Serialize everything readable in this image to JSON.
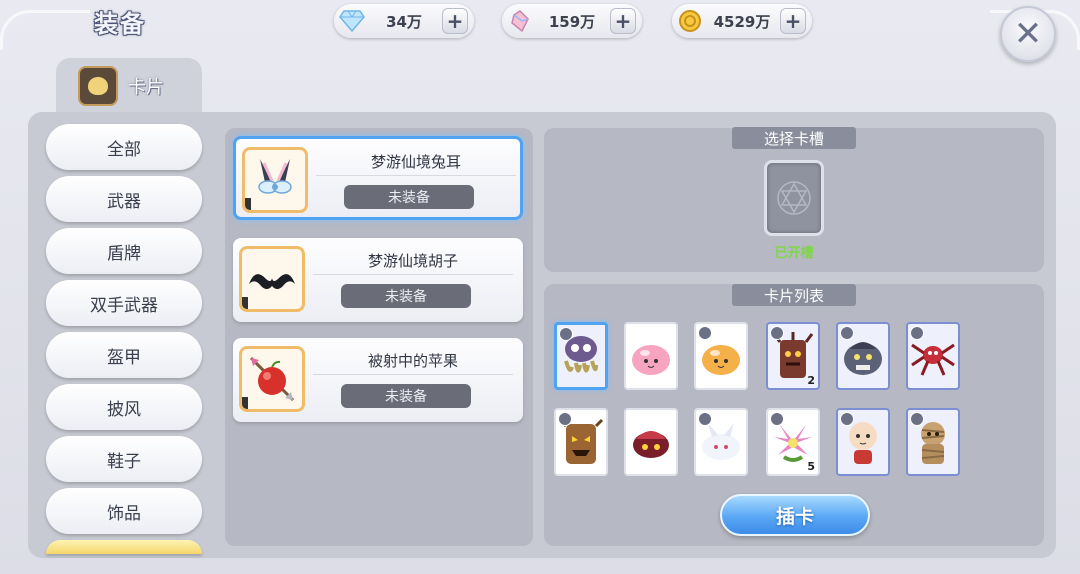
{
  "header": {
    "title": "装备",
    "currencies": [
      {
        "icon": "diamond-icon",
        "value": "34万"
      },
      {
        "icon": "crystal-icon",
        "value": "159万"
      },
      {
        "icon": "gold-coin-icon",
        "value": "4529万"
      }
    ],
    "plus_label": "+",
    "close_label": "✕"
  },
  "tab": {
    "label": "卡片",
    "icon": "card-tab-icon"
  },
  "categories": [
    "全部",
    "武器",
    "盾牌",
    "双手武器",
    "盔甲",
    "披风",
    "鞋子",
    "饰品"
  ],
  "items": [
    {
      "name": "梦游仙境兔耳",
      "status": "未装备",
      "icon": "bunny-ears-icon",
      "selected": true
    },
    {
      "name": "梦游仙境胡子",
      "status": "未装备",
      "icon": "mustache-icon",
      "selected": false
    },
    {
      "name": "被射中的苹果",
      "status": "未装备",
      "icon": "arrow-apple-icon",
      "selected": false
    }
  ],
  "slot": {
    "label": "选择卡槽",
    "status": "已开槽"
  },
  "card_list": {
    "label": "卡片列表",
    "cards": [
      {
        "name": "octopus-monster-card",
        "count": ""
      },
      {
        "name": "pink-poring-card",
        "count": ""
      },
      {
        "name": "orange-poring-card",
        "count": ""
      },
      {
        "name": "tree-monster-card",
        "count": "2"
      },
      {
        "name": "stone-golem-card",
        "count": ""
      },
      {
        "name": "red-spider-card",
        "count": ""
      },
      {
        "name": "tree-stump-card",
        "count": ""
      },
      {
        "name": "red-beetle-card",
        "count": ""
      },
      {
        "name": "white-lunatic-card",
        "count": ""
      },
      {
        "name": "flower-monster-card",
        "count": "5"
      },
      {
        "name": "bald-child-card",
        "count": ""
      },
      {
        "name": "mummy-card",
        "count": ""
      }
    ]
  },
  "insert_button": "插卡",
  "colors": {
    "accent_blue": "#4fa3f0",
    "slot_open": "#7fd64a",
    "item_border": "#f1bc6a"
  }
}
